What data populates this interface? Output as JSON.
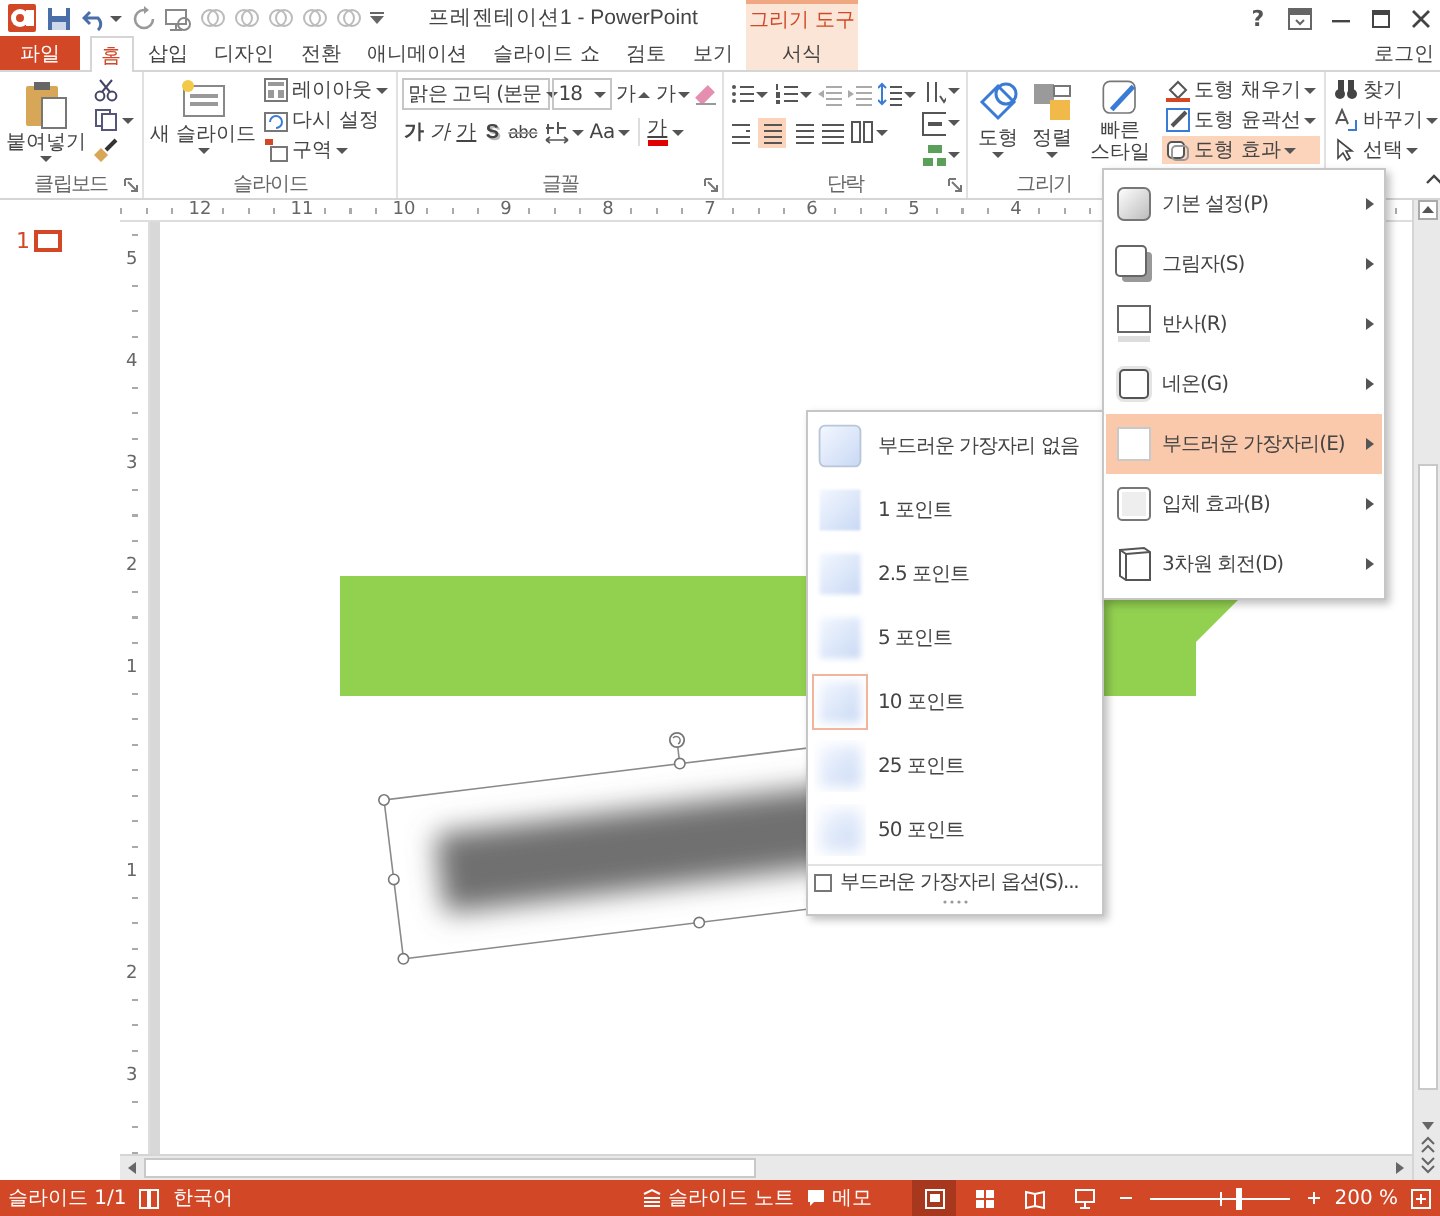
{
  "title_bar": {
    "title": "프레젠테이션1 - PowerPoint",
    "context_label": "그리기 도구",
    "help": "?"
  },
  "tabs": [
    {
      "label": "파일",
      "kind": "file"
    },
    {
      "label": "홈",
      "kind": "tab",
      "selected": true
    },
    {
      "label": "삽입",
      "kind": "tab",
      "selected": false
    },
    {
      "label": "디자인",
      "kind": "tab",
      "selected": false
    },
    {
      "label": "전환",
      "kind": "tab",
      "selected": false
    },
    {
      "label": "애니메이션",
      "kind": "tab",
      "selected": false
    },
    {
      "label": "슬라이드 쇼",
      "kind": "tab",
      "selected": false
    },
    {
      "label": "검토",
      "kind": "tab",
      "selected": false
    },
    {
      "label": "보기",
      "kind": "tab",
      "selected": false
    },
    {
      "label": "서식",
      "kind": "context",
      "selected": false
    }
  ],
  "account": "로그인",
  "ribbon": {
    "clipboard": {
      "paste": "붙여넣기",
      "label": "클립보드"
    },
    "slides": {
      "new_slide": "새 슬라이드",
      "layout": "레이아웃",
      "reset": "다시 설정",
      "section": "구역",
      "label": "슬라이드"
    },
    "font": {
      "name": "맑은 고딕 (본문",
      "size": "18",
      "grow": "가",
      "shrink": "가",
      "bold": "가",
      "italic": "가",
      "underline": "가",
      "shadow": "S",
      "strike": "abc",
      "case": "Aa",
      "font_color": "가",
      "label": "글꼴"
    },
    "paragraph": {
      "align": [
        {
          "selected": false
        },
        {
          "selected": true
        },
        {
          "selected": false
        },
        {
          "selected": false
        },
        {
          "selected": false
        }
      ],
      "label": "단락"
    },
    "drawing": {
      "shapes": "도형",
      "arrange": "정렬",
      "quick_styles": "빠른 스타일",
      "fill": "도형 채우기",
      "outline": "도형 윤곽선",
      "effects": "도형 효과",
      "effects_open": true,
      "label": "그리기"
    },
    "editing": {
      "find": "찾기",
      "replace": "바꾸기",
      "select": "선택"
    }
  },
  "ruler": {
    "horizontal": [
      "12",
      "11",
      "10",
      "9",
      "8",
      "7",
      "6",
      "5",
      "4"
    ],
    "vertical_above": [
      "5",
      "4",
      "3",
      "2",
      "1"
    ],
    "vertical_below": [
      "1",
      "2",
      "3"
    ]
  },
  "thumbnails": [
    {
      "number": "1",
      "selected": true
    }
  ],
  "slide": {
    "shapes": [
      {
        "kind": "banner"
      },
      {
        "kind": "blurred",
        "selected": true
      }
    ]
  },
  "effects_menu": {
    "items": [
      {
        "label": "기본 설정(P)",
        "selected": false
      },
      {
        "label": "그림자(S)",
        "selected": false
      },
      {
        "label": "반사(R)",
        "selected": false
      },
      {
        "label": "네온(G)",
        "selected": false
      },
      {
        "label": "부드러운 가장자리(E)",
        "selected": true
      },
      {
        "label": "입체 효과(B)",
        "selected": false
      },
      {
        "label": "3차원 회전(D)",
        "selected": false
      }
    ]
  },
  "soft_edges_menu": {
    "items": [
      {
        "label": "부드러운 가장자리 없음",
        "selected": false
      },
      {
        "label": "1 포인트",
        "selected": false
      },
      {
        "label": "2.5 포인트",
        "selected": false
      },
      {
        "label": "5 포인트",
        "selected": false
      },
      {
        "label": "10 포인트",
        "selected": true
      },
      {
        "label": "25 포인트",
        "selected": false
      },
      {
        "label": "50 포인트",
        "selected": false
      }
    ],
    "footer": "부드러운 가장자리 옵션(S)..."
  },
  "status_bar": {
    "slide": "슬라이드 1/1",
    "language": "한국어",
    "notes": "슬라이드 노트",
    "comments": "메모",
    "views": [
      {
        "selected": true
      },
      {
        "selected": false
      },
      {
        "selected": false
      },
      {
        "selected": false
      }
    ],
    "zoom": {
      "level": 0.62
    },
    "zoom_label": "200 %"
  }
}
